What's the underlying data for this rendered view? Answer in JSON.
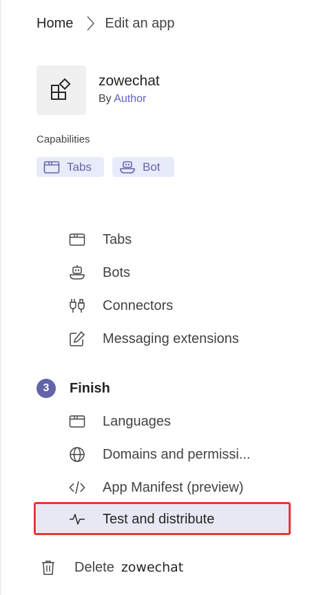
{
  "breadcrumb": {
    "home": "Home",
    "current": "Edit an app"
  },
  "app": {
    "name": "zowechat",
    "by_prefix": "By",
    "author": "Author",
    "icon": "app-icon"
  },
  "capabilities": {
    "heading": "Capabilities",
    "chips": [
      {
        "label": "Tabs",
        "icon": "tabs-icon"
      },
      {
        "label": "Bot",
        "icon": "bot-icon"
      }
    ]
  },
  "nav": {
    "features": [
      {
        "label": "Tabs",
        "icon": "tabs-icon"
      },
      {
        "label": "Bots",
        "icon": "bot-icon"
      },
      {
        "label": "Connectors",
        "icon": "plug-icon"
      },
      {
        "label": "Messaging extensions",
        "icon": "edit-icon"
      }
    ],
    "finish": {
      "step": "3",
      "title": "Finish",
      "items": [
        {
          "label": "Languages",
          "icon": "tabs-icon"
        },
        {
          "label": "Domains and permissi...",
          "icon": "globe-icon"
        },
        {
          "label": "App Manifest (preview)",
          "icon": "code-icon"
        },
        {
          "label": "Test and distribute",
          "icon": "pulse-icon",
          "selected": true
        }
      ]
    }
  },
  "delete": {
    "label": "Delete",
    "app_name": "zowechat",
    "icon": "trash-icon"
  },
  "colors": {
    "accent": "#6264a7",
    "link": "#5b5fc7",
    "chip_bg": "#e8ebfa",
    "selected_bg": "#e8e8f4",
    "highlight": "#e53935"
  }
}
